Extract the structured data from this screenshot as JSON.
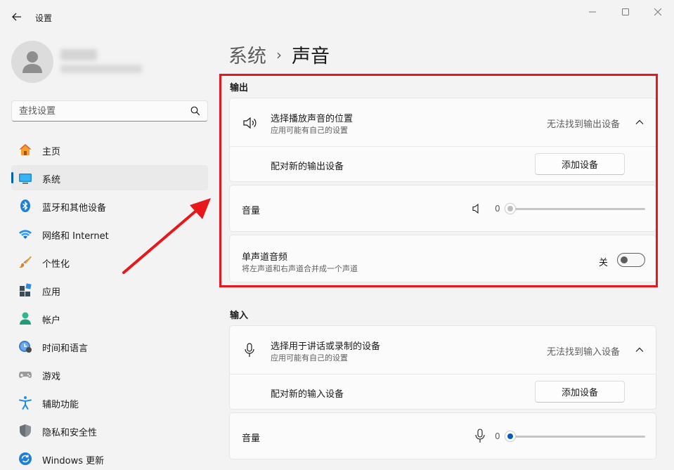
{
  "window": {
    "title": "设置",
    "controls": {
      "minimize": "minimize-icon",
      "maximize": "maximize-icon",
      "close": "close-icon"
    }
  },
  "sidebar": {
    "search_placeholder": "查找设置",
    "items": [
      {
        "label": "主页",
        "icon": "home-icon",
        "active": false
      },
      {
        "label": "系统",
        "icon": "system-monitor-icon",
        "active": true
      },
      {
        "label": "蓝牙和其他设备",
        "icon": "bluetooth-icon",
        "active": false
      },
      {
        "label": "网络和 Internet",
        "icon": "wifi-icon",
        "active": false
      },
      {
        "label": "个性化",
        "icon": "brush-icon",
        "active": false
      },
      {
        "label": "应用",
        "icon": "apps-icon",
        "active": false
      },
      {
        "label": "帐户",
        "icon": "account-icon",
        "active": false
      },
      {
        "label": "时间和语言",
        "icon": "time-language-icon",
        "active": false
      },
      {
        "label": "游戏",
        "icon": "gamepad-icon",
        "active": false
      },
      {
        "label": "辅助功能",
        "icon": "accessibility-icon",
        "active": false
      },
      {
        "label": "隐私和安全性",
        "icon": "shield-icon",
        "active": false
      },
      {
        "label": "Windows 更新",
        "icon": "update-icon",
        "active": false
      }
    ]
  },
  "breadcrumb": {
    "parent": "系统",
    "separator": "›",
    "current": "声音"
  },
  "output": {
    "section_title": "输出",
    "choose_device": {
      "title": "选择播放声音的位置",
      "subtitle": "应用可能有自己的设置",
      "status": "无法找到输出设备"
    },
    "pair": {
      "title": "配对新的输出设备",
      "button": "添加设备"
    },
    "volume": {
      "title": "音量",
      "value": "0"
    },
    "mono": {
      "title": "单声道音频",
      "subtitle": "将左声道和右声道合并成一个声道",
      "state_label": "关",
      "on": false
    }
  },
  "input": {
    "section_title": "输入",
    "choose_device": {
      "title": "选择用于讲话或录制的设备",
      "subtitle": "应用可能有自己的设置",
      "status": "无法找到输入设备"
    },
    "pair": {
      "title": "配对新的输入设备",
      "button": "添加设备"
    },
    "volume": {
      "title": "音量",
      "value": "0"
    }
  },
  "colors": {
    "accent": "#005fb8",
    "annotation": "#e8171b",
    "background": "#f3f3f3",
    "card": "#fbfbfb"
  }
}
